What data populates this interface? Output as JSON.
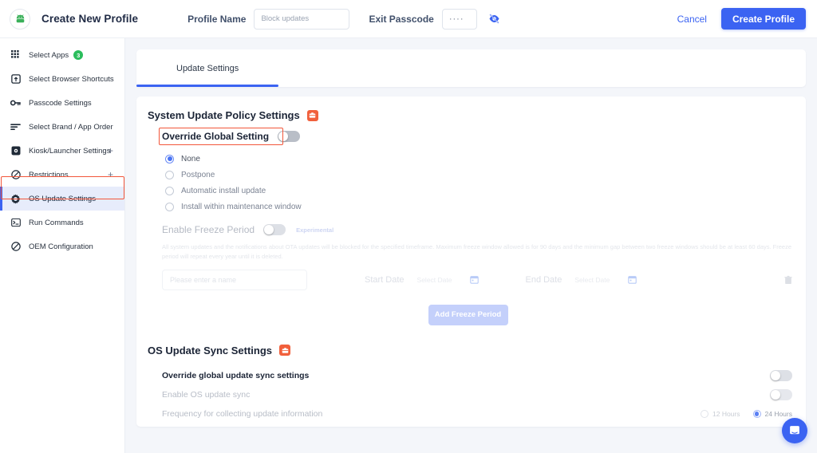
{
  "header": {
    "logo_icon": "android-logo-icon",
    "title": "Create New Profile",
    "profile_name_label": "Profile Name",
    "profile_name_value": "",
    "profile_name_placeholder": "Block updates",
    "exit_passcode_label": "Exit Passcode",
    "exit_passcode_value": "····",
    "eye_icon": "eye-off-icon",
    "cancel_label": "Cancel",
    "create_label": "Create Profile",
    "accent_color": "#3b63f2"
  },
  "sidebar": {
    "items": [
      {
        "label": "Select Apps",
        "icon": "grid-apps-icon",
        "badge": "3",
        "expandable": false,
        "active": false
      },
      {
        "label": "Select Browser Shortcuts",
        "icon": "browser-shortcut-icon",
        "badge": "",
        "expandable": false,
        "active": false
      },
      {
        "label": "Passcode Settings",
        "icon": "key-icon",
        "badge": "",
        "expandable": false,
        "active": false
      },
      {
        "label": "Select Brand / App Order",
        "icon": "sort-lines-icon",
        "badge": "",
        "expandable": false,
        "active": false
      },
      {
        "label": "Kiosk/Launcher Settings",
        "icon": "kiosk-icon",
        "badge": "",
        "expandable": true,
        "active": false
      },
      {
        "label": "Restrictions",
        "icon": "block-circle-icon",
        "badge": "",
        "expandable": true,
        "active": false
      },
      {
        "label": "OS Update Settings",
        "icon": "gear-icon",
        "badge": "",
        "expandable": false,
        "active": true
      },
      {
        "label": "Run Commands",
        "icon": "terminal-icon",
        "badge": "",
        "expandable": false,
        "active": false
      },
      {
        "label": "OEM Configuration",
        "icon": "block-circle-icon",
        "badge": "",
        "expandable": false,
        "active": false
      }
    ],
    "expand_glyph": "+",
    "highlight_color": "#f2563a"
  },
  "main": {
    "tab_label": "Update Settings",
    "policy": {
      "section_title": "System Update Policy Settings",
      "work_badge_icon": "work-briefcase-icon",
      "override_label": "Override Global Setting",
      "override_enabled": false,
      "options": [
        {
          "label": "None",
          "selected": true
        },
        {
          "label": "Postpone",
          "selected": false
        },
        {
          "label": "Automatic install update",
          "selected": false
        },
        {
          "label": "Install within maintenance window",
          "selected": false
        }
      ]
    },
    "freeze": {
      "enable_label": "Enable Freeze Period",
      "experimental_label": "Experimental",
      "enabled": false,
      "disclaimer": "All system updates and the notifications about OTA updates will be blocked for the specified timeframe. Maximum freeze window allowed is for 90 days and the minimum gap between two freeze windows should be at least 60 days. Freeze period will repeat every year until it is deleted.",
      "name_placeholder": "Please enter a name",
      "name_value": "",
      "start_date_label": "Start Date",
      "start_date_placeholder": "Select Date",
      "end_date_label": "End Date",
      "end_date_placeholder": "Select Date",
      "calendar_icon": "calendar-icon",
      "delete_icon": "trash-icon",
      "add_button_label": "Add Freeze Period"
    },
    "sync": {
      "section_title": "OS Update Sync Settings",
      "work_badge_icon": "work-briefcase-icon",
      "rows": [
        {
          "label": "Override global update sync settings",
          "strong": true,
          "toggle_on": false
        },
        {
          "label": "Enable OS update sync",
          "strong": false,
          "toggle_on": false
        }
      ],
      "frequency_label": "Frequency for collecting update information",
      "frequency_options": [
        {
          "label": "12 Hours",
          "selected": false
        },
        {
          "label": "24 Hours",
          "selected": true
        }
      ]
    }
  },
  "chat": {
    "icon": "chat-bubble-icon"
  }
}
